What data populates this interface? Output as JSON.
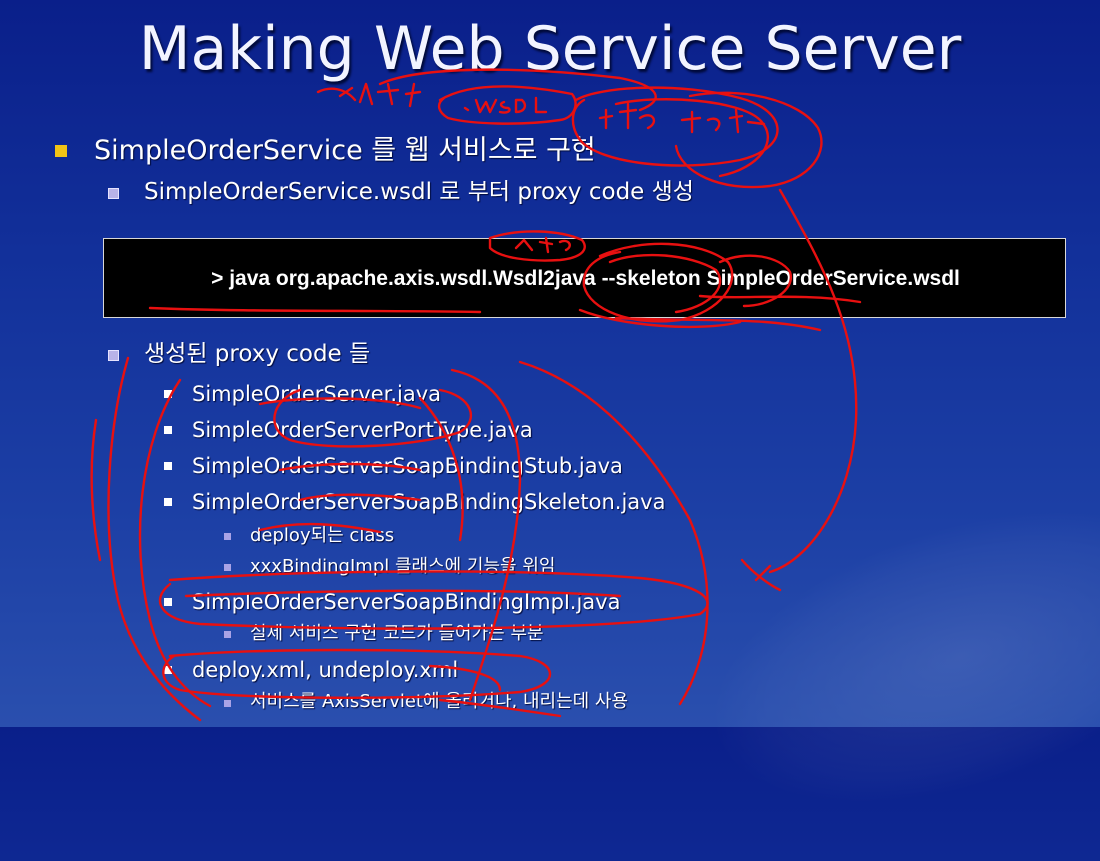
{
  "slide": {
    "title": "Making Web Service Server",
    "bullets": [
      {
        "text": "SimpleOrderService 를 웹 서비스로 구현"
      },
      {
        "text": "SimpleOrderService.wsdl 로 부터 proxy code 생성"
      },
      {
        "text": "생성된 proxy code 들"
      }
    ],
    "command": "> java org.apache.axis.wsdl.Wsdl2java --skeleton SimpleOrderService.wsdl",
    "files": [
      {
        "text": "SimpleOrderServer.java"
      },
      {
        "text": "SimpleOrderServerPortType.java"
      },
      {
        "text": "SimpleOrderServerSoapBindingStub.java"
      },
      {
        "text": "SimpleOrderServerSoapBindingSkeleton.java"
      },
      {
        "text": "SimpleOrderServerSoapBindingImpl.java"
      },
      {
        "text": "deploy.xml, undeploy.xml"
      }
    ],
    "notes": [
      {
        "text": "deploy되는 class"
      },
      {
        "text": "xxxBindingImpl 클래스에 기능을 위임"
      },
      {
        "text": "실제 서비스 구현 코드가 들어가는 부분"
      },
      {
        "text": "서비스를 AxisServlet에 올리거나, 내리는데 사용"
      }
    ],
    "annotation_color": "#e81010"
  }
}
